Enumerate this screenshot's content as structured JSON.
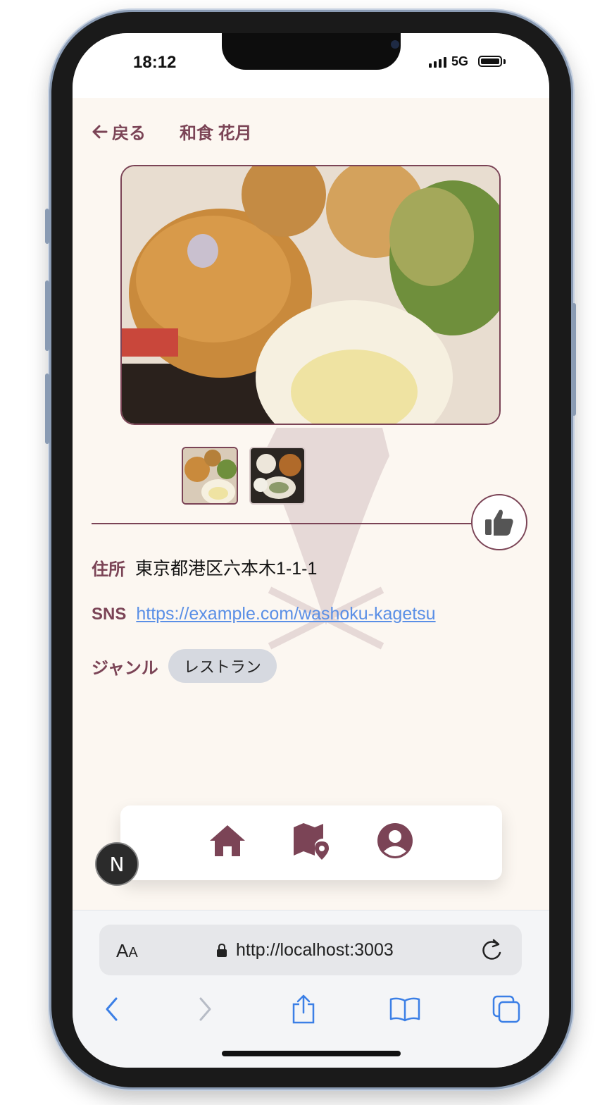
{
  "status_bar": {
    "time": "18:12",
    "network": "5G"
  },
  "header": {
    "back_label": "戻る",
    "title": "和食 花月"
  },
  "details": {
    "address_label": "住所",
    "address_value": "東京都港区六本木1-1-1",
    "sns_label": "SNS",
    "sns_url": "https://example.com/washoku-kagetsu",
    "genre_label": "ジャンル",
    "genre_chip": "レストラン"
  },
  "browser": {
    "url": "http://localhost:3003",
    "text_size_label": "A",
    "text_size_small": "A"
  },
  "dev_badge": "N",
  "colors": {
    "accent": "#7b4456",
    "background": "#fcf7f1",
    "link": "#5a8fe6",
    "chip": "#d6d9e0"
  },
  "icons": [
    "arrow-left-icon",
    "thumbs-up-icon",
    "home-icon",
    "map-pin-icon",
    "user-circle-icon",
    "lock-icon",
    "reload-icon",
    "chevron-left-icon",
    "chevron-right-icon",
    "share-icon",
    "book-icon",
    "tabs-icon"
  ]
}
